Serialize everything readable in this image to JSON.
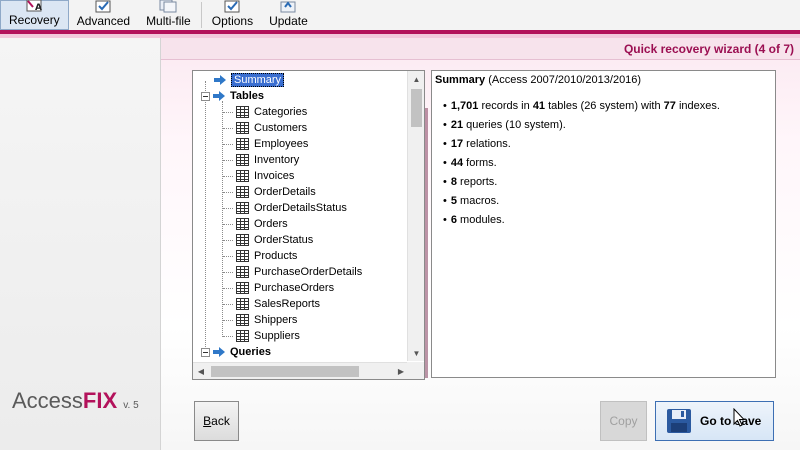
{
  "toolbar": {
    "items": [
      {
        "label": "Recovery",
        "active": true,
        "icon": "recovery-icon"
      },
      {
        "label": "Advanced",
        "active": false,
        "icon": "advanced-icon"
      },
      {
        "label": "Multi-file",
        "active": false,
        "icon": "multi-file-icon"
      },
      {
        "label": "Options",
        "active": false,
        "icon": "options-icon"
      },
      {
        "label": "Update",
        "active": false,
        "icon": "update-icon"
      }
    ]
  },
  "brand": {
    "name_part1": "Access",
    "name_part2": "FIX",
    "version": "v. 5"
  },
  "wizard": {
    "title": "Quick recovery wizard (4 of 7)"
  },
  "tree": {
    "summary_label": "Summary",
    "tables_label": "Tables",
    "queries_label": "Queries",
    "tables": [
      "Categories",
      "Customers",
      "Employees",
      "Inventory",
      "Invoices",
      "OrderDetails",
      "OrderDetailsStatus",
      "Orders",
      "OrderStatus",
      "Products",
      "PurchaseOrderDetails",
      "PurchaseOrders",
      "SalesReports",
      "Shippers",
      "Suppliers"
    ]
  },
  "summary": {
    "heading": "Summary",
    "heading_suffix": " (Access 2007/2010/2013/2016)",
    "items": [
      {
        "b1": "1,701",
        "t1": " records in ",
        "b2": "41",
        "t2": " tables (26 system) with ",
        "b3": "77",
        "t3": " indexes."
      },
      {
        "b1": "21",
        "t1": " queries (10 system)."
      },
      {
        "b1": "17",
        "t1": " relations."
      },
      {
        "b1": "44",
        "t1": " forms."
      },
      {
        "b1": "8",
        "t1": " reports."
      },
      {
        "b1": "5",
        "t1": " macros."
      },
      {
        "b1": "6",
        "t1": " modules."
      }
    ]
  },
  "buttons": {
    "back": {
      "u": "B",
      "rest": "ack"
    },
    "copy": "Copy",
    "goto": "Go to save"
  },
  "colors": {
    "accent": "#b3125b",
    "selection": "#3a6ed0"
  }
}
